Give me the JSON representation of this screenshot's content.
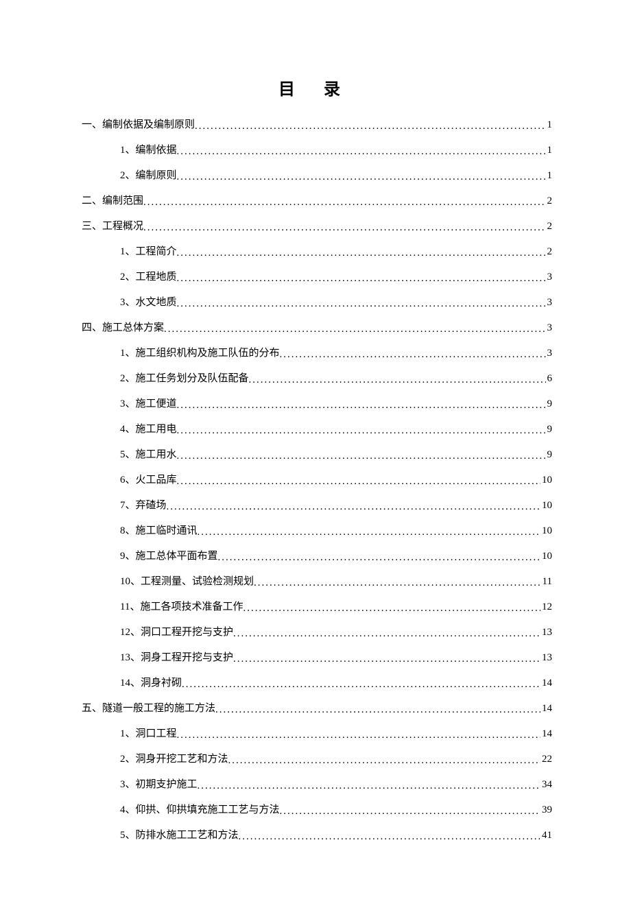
{
  "title": "目  录",
  "entries": [
    {
      "level": 1,
      "label": "一、编制依据及编制原则 ",
      "page": "1"
    },
    {
      "level": 2,
      "label": "1、编制依据 ",
      "page": "1"
    },
    {
      "level": 2,
      "label": "2、编制原则 ",
      "page": "1"
    },
    {
      "level": 1,
      "label": "二、编制范围 ",
      "page": "2"
    },
    {
      "level": 1,
      "label": "三、工程概况 ",
      "page": "2"
    },
    {
      "level": 2,
      "label": "1、工程简介 ",
      "page": "2"
    },
    {
      "level": 2,
      "label": "2、工程地质 ",
      "page": "3"
    },
    {
      "level": 2,
      "label": "3、水文地质 ",
      "page": "3"
    },
    {
      "level": 1,
      "label": "四、施工总体方案 ",
      "page": "3"
    },
    {
      "level": 2,
      "label": "1、施工组织机构及施工队伍的分布 ",
      "page": "3"
    },
    {
      "level": 2,
      "label": "2、施工任务划分及队伍配备 ",
      "page": "6"
    },
    {
      "level": 2,
      "label": "3、施工便道 ",
      "page": "9"
    },
    {
      "level": 2,
      "label": "4、施工用电 ",
      "page": "9"
    },
    {
      "level": 2,
      "label": "5、施工用水 ",
      "page": "9"
    },
    {
      "level": 2,
      "label": "6、火工品库 ",
      "page": "10"
    },
    {
      "level": 2,
      "label": "7、弃碴场 ",
      "page": "10"
    },
    {
      "level": 2,
      "label": "8、施工临时通讯 ",
      "page": "10"
    },
    {
      "level": 2,
      "label": "9、施工总体平面布置 ",
      "page": "10"
    },
    {
      "level": 2,
      "label": "10、工程测量、试验检测规划 ",
      "page": "11"
    },
    {
      "level": 2,
      "label": "11、施工各项技术准备工作 ",
      "page": "12"
    },
    {
      "level": 2,
      "label": "12、洞口工程开挖与支护 ",
      "page": "13"
    },
    {
      "level": 2,
      "label": "13、洞身工程开挖与支护 ",
      "page": "13"
    },
    {
      "level": 2,
      "label": "14、洞身衬砌 ",
      "page": "14"
    },
    {
      "level": 1,
      "label": "五、隧道一般工程的施工方法 ",
      "page": "14"
    },
    {
      "level": 2,
      "label": "1、洞口工程 ",
      "page": "14"
    },
    {
      "level": 2,
      "label": "2、洞身开挖工艺和方法 ",
      "page": "22"
    },
    {
      "level": 2,
      "label": "3、初期支护施工 ",
      "page": "34"
    },
    {
      "level": 2,
      "label": "4、仰拱、仰拱填充施工工艺与方法 ",
      "page": "39"
    },
    {
      "level": 2,
      "label": "5、防排水施工工艺和方法 ",
      "page": "41"
    }
  ]
}
